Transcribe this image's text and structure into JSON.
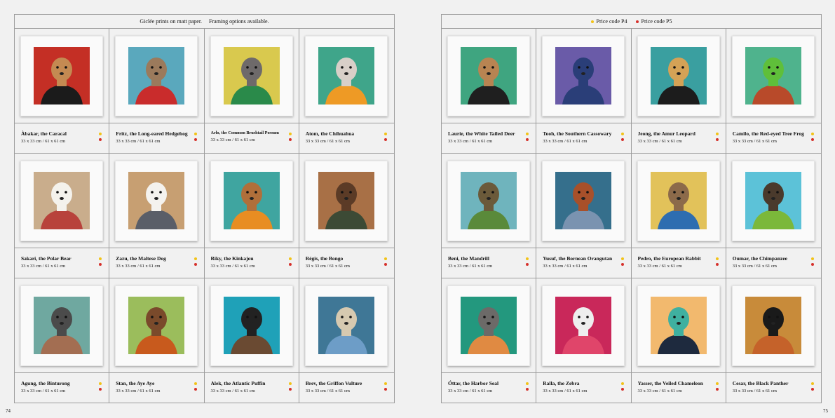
{
  "colors": {
    "yellow": "#f2c318",
    "red": "#d6312b"
  },
  "left_page": {
    "header_text_1": "Giclée prints on matt paper.",
    "header_text_2": "Framing options available.",
    "page_number": "74",
    "items": [
      {
        "name": "Àbakar, the Caracal",
        "size": "33 x 33 cm / 61 x 61 cm",
        "bg": "#c42f25",
        "animal": "#c48a52",
        "cloth": "#1b1b1b"
      },
      {
        "name": "Fritz, the Long-eared Hedgehog",
        "size": "33 x 33 cm / 61 x 61 cm",
        "bg": "#5aa8bd",
        "animal": "#9b7a5c",
        "cloth": "#c92c2c"
      },
      {
        "name": "Arlo, the Common Brushtail Possum",
        "size": "33 x 33 cm / 61 x 61 cm",
        "bg": "#d9c94e",
        "animal": "#6e6a6a",
        "cloth": "#2a8a4a"
      },
      {
        "name": "Atom, the Chihuahua",
        "size": "33 x 33 cm / 61 x 61 cm",
        "bg": "#3fa58a",
        "animal": "#d8cfc8",
        "cloth": "#ee9a25"
      },
      {
        "name": "Sakari, the Polar Bear",
        "size": "33 x 33 cm / 61 x 61 cm",
        "bg": "#c9ad8c",
        "animal": "#f4f2ec",
        "cloth": "#b8423b"
      },
      {
        "name": "Zazu, the Maltese Dog",
        "size": "33 x 33 cm / 61 x 61 cm",
        "bg": "#c79f72",
        "animal": "#f4f2ee",
        "cloth": "#5a5e68"
      },
      {
        "name": "Riky, the Kinkajou",
        "size": "33 x 33 cm / 61 x 61 cm",
        "bg": "#3fa5a0",
        "animal": "#b06f3a",
        "cloth": "#e88d22"
      },
      {
        "name": "Régis, the Bongo",
        "size": "33 x 33 cm / 61 x 61 cm",
        "bg": "#a87046",
        "animal": "#5b3b26",
        "cloth": "#3c4a35"
      },
      {
        "name": "Agung, the Binturong",
        "size": "33 x 33 cm / 61 x 61 cm",
        "bg": "#6fa8a0",
        "animal": "#4b4b4b",
        "cloth": "#a36e52"
      },
      {
        "name": "Stan, the Aye Aye",
        "size": "33 x 33 cm / 61 x 61 cm",
        "bg": "#9bbd5c",
        "animal": "#7a4a2b",
        "cloth": "#c85a1d"
      },
      {
        "name": "Alek, the Atlantic Puffin",
        "size": "33 x 33 cm / 61 x 61 cm",
        "bg": "#1fa1b8",
        "animal": "#222222",
        "cloth": "#6a4a32"
      },
      {
        "name": "Brev, the Griffon Vulture",
        "size": "33 x 33 cm / 61 x 61 cm",
        "bg": "#3f7796",
        "animal": "#d6c9b0",
        "cloth": "#6d9dc7"
      }
    ]
  },
  "right_page": {
    "legend_p4": "Price code P4",
    "legend_p5": "Price code P5",
    "page_number": "75",
    "items": [
      {
        "name": "Laurie, the White Tailed Deer",
        "size": "33 x 33 cm / 61 x 61 cm",
        "bg": "#3fa580",
        "animal": "#b88452",
        "cloth": "#1f1f1f"
      },
      {
        "name": "Tooh, the Southern Cassowary",
        "size": "33 x 33 cm / 61 x 61 cm",
        "bg": "#6a5ba8",
        "animal": "#2a3e78",
        "cloth": "#2a3e78"
      },
      {
        "name": "Jeong, the Amur Leopard",
        "size": "33 x 33 cm / 61 x 61 cm",
        "bg": "#3a9fa0",
        "animal": "#d4a256",
        "cloth": "#1c1c1c"
      },
      {
        "name": "Camilo, the Red-eyed Tree Frog",
        "size": "33 x 33 cm / 61 x 61 cm",
        "bg": "#4fb38d",
        "animal": "#5fbf3a",
        "cloth": "#b84a2a"
      },
      {
        "name": "Beni, the Mandrill",
        "size": "33 x 33 cm / 61 x 61 cm",
        "bg": "#6fb4bd",
        "animal": "#6b5a3a",
        "cloth": "#5a8a3a"
      },
      {
        "name": "Yusuf, the Bornean Orangutan",
        "size": "33 x 33 cm / 61 x 61 cm",
        "bg": "#356f8c",
        "animal": "#a8502a",
        "cloth": "#7a93b0"
      },
      {
        "name": "Pedro, the European Rabbit",
        "size": "33 x 33 cm / 61 x 61 cm",
        "bg": "#e2c25a",
        "animal": "#8c6a4a",
        "cloth": "#2e6db0"
      },
      {
        "name": "Oumar, the Chimpanzee",
        "size": "33 x 33 cm / 61 x 61 cm",
        "bg": "#5cc2d8",
        "animal": "#4a3a2c",
        "cloth": "#7bb83a"
      },
      {
        "name": "Óttar, the Harbor Seal",
        "size": "33 x 33 cm / 61 x 61 cm",
        "bg": "#23987e",
        "animal": "#6c6a68",
        "cloth": "#e08a42"
      },
      {
        "name": "Ralla, the Zebra",
        "size": "33 x 33 cm / 61 x 61 cm",
        "bg": "#c9285a",
        "animal": "#eeeeee",
        "cloth": "#e0456a"
      },
      {
        "name": "Yasser, the Veiled Chameleon",
        "size": "33 x 33 cm / 61 x 61 cm",
        "bg": "#f2b96e",
        "animal": "#3fb0a0",
        "cloth": "#1e2a3e"
      },
      {
        "name": "Cesar, the Black Panther",
        "size": "33 x 33 cm / 61 x 61 cm",
        "bg": "#c88b3a",
        "animal": "#1a1a1a",
        "cloth": "#c5622a"
      }
    ]
  }
}
